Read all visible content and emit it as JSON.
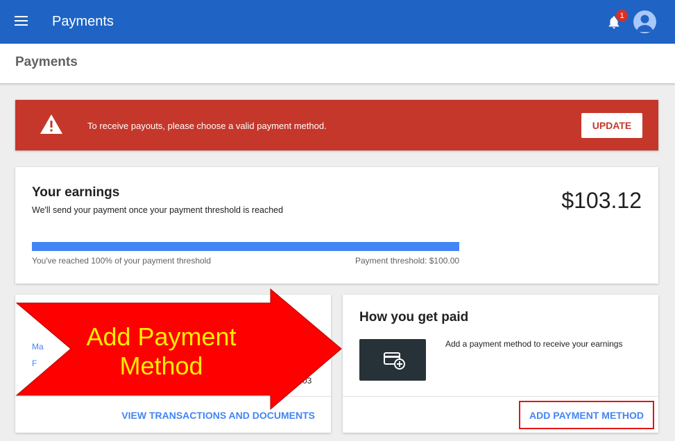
{
  "topbar": {
    "title": "Payments",
    "notification_count": "1",
    "menu_icon": "menu-icon",
    "bell_icon": "bell-icon",
    "avatar_icon": "avatar-icon"
  },
  "subheader": {
    "title": "Payments"
  },
  "alert": {
    "message": "To receive payouts, please choose a valid payment method.",
    "button_label": "UPDATE",
    "icon": "warning-icon",
    "color": "#c5372a"
  },
  "earnings": {
    "title": "Your earnings",
    "subtitle": "We'll send your payment once your payment threshold is reached",
    "amount": "$103.12",
    "progress_percent": 100,
    "progress_text": "You've reached 100% of your payment threshold",
    "threshold_text": "Payment threshold: $100.00"
  },
  "transactions_card": {
    "partial_link_1": "Ma",
    "partial_link_2": "F",
    "partial_value": "03",
    "link_label": "VIEW TRANSACTIONS AND DOCUMENTS"
  },
  "how_paid": {
    "title": "How you get paid",
    "description": "Add a payment method to receive your earnings",
    "link_label": "ADD PAYMENT METHOD",
    "icon": "add-card-icon"
  },
  "annotation": {
    "line1": "Add Payment",
    "line2": "Method",
    "color": "#ffee00",
    "arrow_color": "#ff0000"
  },
  "colors": {
    "primary": "#1f64c4",
    "accent": "#4285f4"
  }
}
